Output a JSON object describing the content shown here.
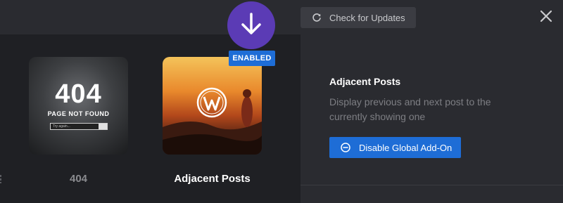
{
  "header": {
    "check_updates_label": "Check for Updates",
    "refresh_icon": "refresh-icon",
    "close_icon": "close-icon"
  },
  "cards": [
    {
      "label": "404",
      "thumb_big_text": "404",
      "thumb_sub_text": "PAGE NOT FOUND",
      "thumb_search_placeholder": "Try again..."
    },
    {
      "label": "Adjacent Posts",
      "status_badge": "ENABLED",
      "logo_icon": "wordpress-icon"
    }
  ],
  "panel": {
    "title": "Adjacent Posts",
    "description": "Display previous and next post to the currently showing one",
    "disable_label": "Disable Global Add-On",
    "disable_icon": "minus-circle-icon"
  },
  "colors": {
    "accent": "#1e6dd6",
    "badge_purple": "#5b3bb5",
    "background": "#1f2024",
    "panel": "#2a2b30"
  }
}
